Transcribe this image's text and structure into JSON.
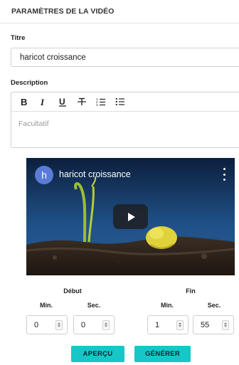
{
  "header": {
    "title": "PARAMÈTRES DE LA VIDÉO"
  },
  "form": {
    "title_label": "Titre",
    "title_value": "haricot croissance",
    "description_label": "Description",
    "description_placeholder": "Facultatif",
    "toolbar": [
      {
        "name": "bold-icon",
        "glyph": "B"
      },
      {
        "name": "italic-icon",
        "glyph": "I"
      },
      {
        "name": "underline-icon",
        "glyph": "U"
      },
      {
        "name": "strikethrough-icon",
        "glyph": "S"
      },
      {
        "name": "ordered-list-icon",
        "glyph": "ol"
      },
      {
        "name": "bullet-list-icon",
        "glyph": "ul"
      }
    ]
  },
  "video": {
    "channel_initial": "h",
    "title": "haricot croissance",
    "menu_icon": "more-vert-icon",
    "play_icon": "play-icon"
  },
  "range": {
    "start_label": "Début",
    "end_label": "Fin",
    "min_label": "Min.",
    "sec_label": "Sec.",
    "start_min": "0",
    "start_sec": "0",
    "end_min": "1",
    "end_sec": "55"
  },
  "actions": {
    "preview_label": "APERÇU",
    "generate_label": "GÉNÉRER"
  },
  "colors": {
    "accent": "#17c7c7",
    "avatar": "#5a7bd6"
  }
}
